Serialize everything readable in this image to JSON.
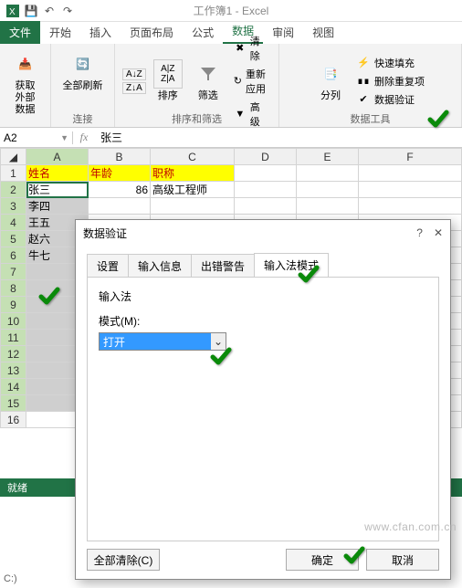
{
  "app": {
    "title": "工作簿1 - Excel"
  },
  "ribbon": {
    "tabs": {
      "file": "文件",
      "home": "开始",
      "insert": "插入",
      "layout": "页面布局",
      "formula": "公式",
      "data": "数据",
      "review": "审阅",
      "view": "视图"
    },
    "groups": {
      "external": {
        "btn": "获取\n外部数据",
        "label": ""
      },
      "connections": {
        "refresh": "全部刷新",
        "label": "连接"
      },
      "sort": {
        "sort": "排序",
        "filter": "筛选",
        "clear": "清除",
        "reapply": "重新应用",
        "advanced": "高级",
        "label": "排序和筛选"
      },
      "datatools": {
        "texttocols": "分列",
        "flashfill": "快速填充",
        "removedup": "删除重复项",
        "validation": "数据验证",
        "label": "数据工具"
      }
    }
  },
  "namebox": {
    "ref": "A2"
  },
  "formula": {
    "value": "张三"
  },
  "sheet": {
    "cols": [
      "A",
      "B",
      "C",
      "D",
      "E",
      "F"
    ],
    "rows": 16,
    "header": {
      "a": "姓名",
      "b": "年龄",
      "c": "职称"
    },
    "data": [
      {
        "a": "张三",
        "b": "86",
        "c": "高级工程师"
      },
      {
        "a": "李四"
      },
      {
        "a": "王五"
      },
      {
        "a": "赵六"
      },
      {
        "a": "牛七"
      }
    ]
  },
  "statusbar": {
    "text": "就绪"
  },
  "dialog": {
    "title": "数据验证",
    "tabs": {
      "settings": "设置",
      "input": "输入信息",
      "error": "出错警告",
      "ime": "输入法模式"
    },
    "section": "输入法",
    "mode_label": "模式(M):",
    "mode_value": "打开",
    "clear_all": "全部清除(C)",
    "ok": "确定",
    "cancel": "取消"
  },
  "watermark": "www.cfan.com.cn",
  "footer": "C:)"
}
